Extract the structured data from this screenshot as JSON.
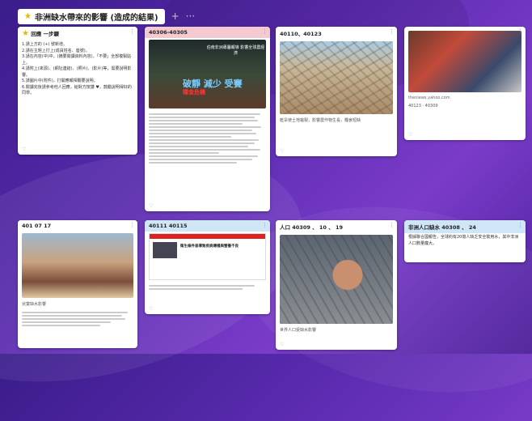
{
  "board": {
    "title": "非洲缺水帶來的影響 (造成的結果)",
    "add_icon": "+",
    "more_icon": "···"
  },
  "cards": {
    "c1": {
      "title": "回應 一步驟",
      "lines": [
        "1.請上方的 (+) 號新增。",
        "2.請在主題上打上(成員姓名、座號)。",
        "3.請在內容(中)中，(摘要閱讀資料內容)，「不要」全部複製貼上。",
        "4.請附上(來源)、(網址連結)、(照片)、(影片)等，需要說明影響。",
        "5.請圖片中(附件)，打開應報相關要說明。",
        "6.閱讀完後請參考他人回應，給對方按讚 ♥，鼓勵說明得好的同學。"
      ]
    },
    "c2": {
      "title": "40306-40305",
      "poster_head": "伯南非洲專屬報導 影響全球農經濟",
      "poster_big": "破靜 減少 受賽",
      "poster_small": "糧食危機"
    },
    "c3": {
      "title": "40110、40123",
      "caption": "乾旱使土地龜裂，影響農作物生長，糧食短缺"
    },
    "c4": {
      "title": "",
      "source": "theniews.yahoo.com",
      "caption": "40123 · 40309"
    },
    "c5": {
      "title": "401 07 17",
      "caption": "兒童缺水影響"
    },
    "c6": {
      "title": "40111 40115",
      "headline": "衛生條件差導致疾病傳播與營養不良"
    },
    "c7": {
      "title": "人口 40309 、 10 、 19",
      "caption": "世界人口受缺水影響"
    },
    "c8": {
      "title": "非洲人口缺水 40308 、 24",
      "body": "根據聯合國報告，全球約有20億人缺乏安全飲用水，其中非洲人口數量龐大。"
    }
  },
  "icons": {
    "heart": "♡",
    "menu": "⋮",
    "star": "★"
  }
}
